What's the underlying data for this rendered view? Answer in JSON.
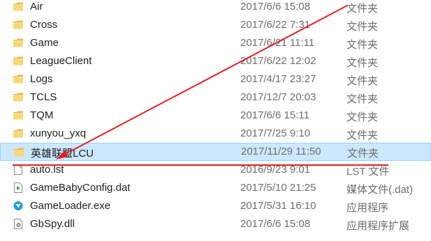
{
  "files": [
    {
      "name": "Air",
      "date": "2017/6/6 15:08",
      "type": "文件夹",
      "icon": "folder-icon",
      "selected": false
    },
    {
      "name": "Cross",
      "date": "2017/6/22 7:31",
      "type": "文件夹",
      "icon": "folder-icon",
      "selected": false
    },
    {
      "name": "Game",
      "date": "2017/6/21 11:11",
      "type": "文件夹",
      "icon": "folder-icon",
      "selected": false
    },
    {
      "name": "LeagueClient",
      "date": "2017/6/22 12:02",
      "type": "文件夹",
      "icon": "folder-icon",
      "selected": false
    },
    {
      "name": "Logs",
      "date": "2017/4/17 23:27",
      "type": "文件夹",
      "icon": "folder-icon",
      "selected": false
    },
    {
      "name": "TCLS",
      "date": "2017/12/7 20:03",
      "type": "文件夹",
      "icon": "folder-icon",
      "selected": false
    },
    {
      "name": "TQM",
      "date": "2017/6/6 15:11",
      "type": "文件夹",
      "icon": "folder-icon",
      "selected": false
    },
    {
      "name": "xunyou_yxq",
      "date": "2017/7/25 9:10",
      "type": "文件夹",
      "icon": "folder-icon",
      "selected": false
    },
    {
      "name": "英雄联盟LCU",
      "date": "2017/11/29 11:50",
      "type": "文件夹",
      "icon": "folder-icon",
      "selected": true
    },
    {
      "name": "auto.lst",
      "date": "2016/9/23 9:01",
      "type": "LST 文件",
      "icon": "document-icon",
      "selected": false
    },
    {
      "name": "GameBabyConfig.dat",
      "date": "2017/5/10 21:25",
      "type": "媒体文件(.dat)",
      "icon": "media-file-icon",
      "selected": false
    },
    {
      "name": "GameLoader.exe",
      "date": "2017/5/31 16:10",
      "type": "应用程序",
      "icon": "game-loader-app-icon",
      "selected": false
    },
    {
      "name": "GbSpy.dll",
      "date": "2017/6/6 15:08",
      "type": "应用程序扩展",
      "icon": "dll-file-icon",
      "selected": false
    }
  ],
  "colors": {
    "selection_bg": "#cce8ff",
    "selection_border": "#99d1ff",
    "annotation_red": "#e02020",
    "folder_yellow": "#f8d775"
  }
}
